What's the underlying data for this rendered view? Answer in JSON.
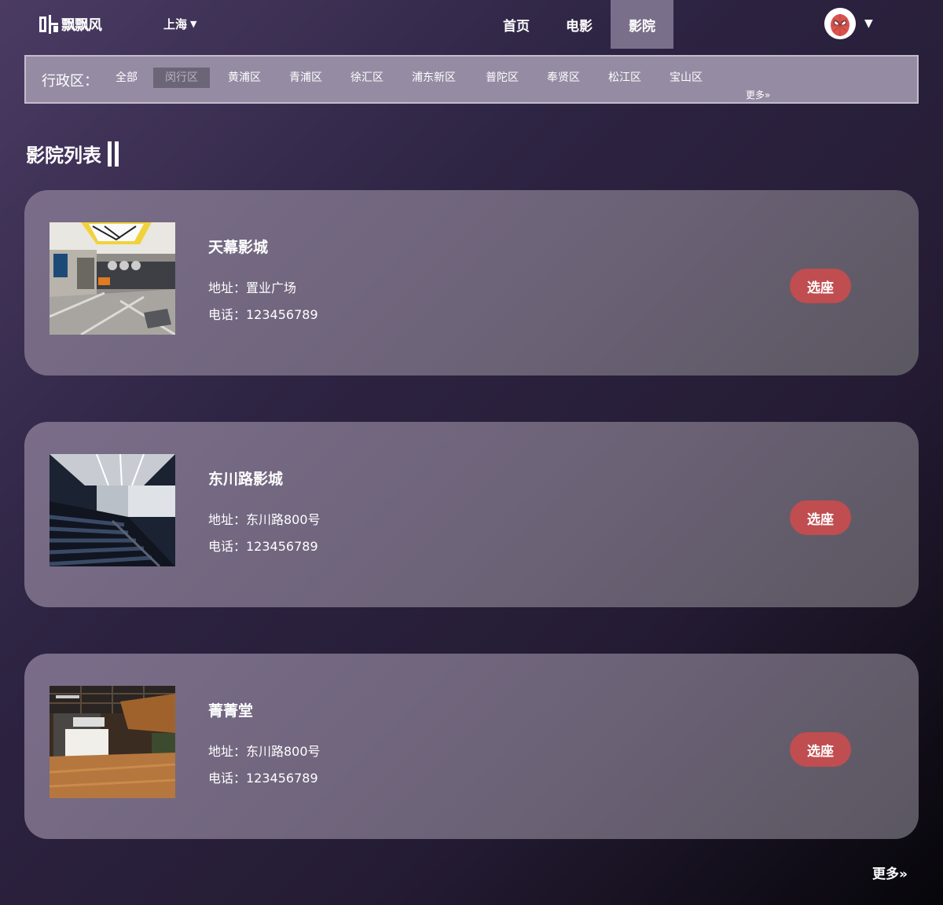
{
  "header": {
    "logo_text": "飘飘风",
    "city": "上海",
    "nav": [
      {
        "label": "首页",
        "active": false
      },
      {
        "label": "电影",
        "active": false
      },
      {
        "label": "影院",
        "active": true
      }
    ]
  },
  "filter": {
    "label": "行政区：",
    "districts": [
      {
        "label": "全部",
        "active": false
      },
      {
        "label": "闵行区",
        "active": true
      },
      {
        "label": "黄浦区",
        "active": false
      },
      {
        "label": "青浦区",
        "active": false
      },
      {
        "label": "徐汇区",
        "active": false
      },
      {
        "label": "浦东新区",
        "active": false
      },
      {
        "label": "普陀区",
        "active": false
      },
      {
        "label": "奉贤区",
        "active": false
      },
      {
        "label": "松江区",
        "active": false
      },
      {
        "label": "宝山区",
        "active": false
      }
    ],
    "more": "更多»"
  },
  "section_title": "影院列表",
  "cinemas": [
    {
      "name": "天幕影城",
      "address": "地址：置业广场",
      "phone": "电话：123456789",
      "button": "选座"
    },
    {
      "name": "东川路影城",
      "address": "地址：东川路800号",
      "phone": "电话：123456789",
      "button": "选座"
    },
    {
      "name": "菁菁堂",
      "address": "地址：东川路800号",
      "phone": "电话：123456789",
      "button": "选座"
    }
  ],
  "more_bottom": "更多»",
  "colors": {
    "accent_button": "#c04d50",
    "active_nav": "#7a6f8a",
    "filter_bg": "#958ba3"
  }
}
